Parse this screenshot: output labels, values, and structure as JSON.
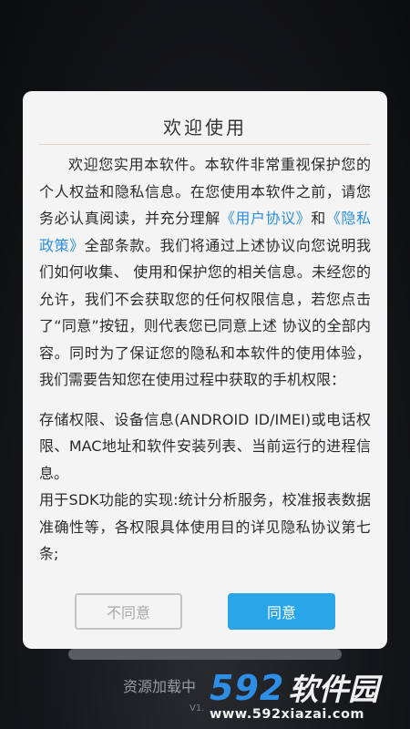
{
  "dialog": {
    "title": "欢迎使用",
    "intro": {
      "text1": "欢迎您实用本软件。本软件非常重视保护您的个人权益和隐私信息。在您使用本软件之前，请您务必认真阅读，并充分理解",
      "link1": "《用户协议》",
      "text2": "和",
      "link2": "《隐私政策》",
      "text3": "全部条款。我们将通过上述协议向您说明我们如何收集、 使用和保护您的相关信息。未经您的允许，我们不会获取您的任何权限信息，若您点击了“同意”按钮，则代表您已同意上述 协议的全部内容。同时为了保证您的隐私和本软件的使用体验，我们需要告知您在使用过程中获取的手机权限："
    },
    "permissions_text": "存储权限、设备信息(ANDROID ID/IMEI)或电话权限、MAC地址和软件安装列表、当前运行的进程信息。",
    "sdk_text": "用于SDK功能的实现:统计分析服务，校准报表数据准确性等，各权限具体使用目的详见隐私协议第七条;",
    "disagree_label": "不同意",
    "agree_label": "同意"
  },
  "background": {
    "loading_text": "资源加载中",
    "version_text": "V1."
  },
  "watermark": {
    "brand_number": "592",
    "brand_name": "软件园",
    "url": "www.592xiazai.com"
  },
  "colors": {
    "link": "#2a8ee0",
    "agree_button": "#29a5ea",
    "watermark_number": "#2e8ee6"
  }
}
